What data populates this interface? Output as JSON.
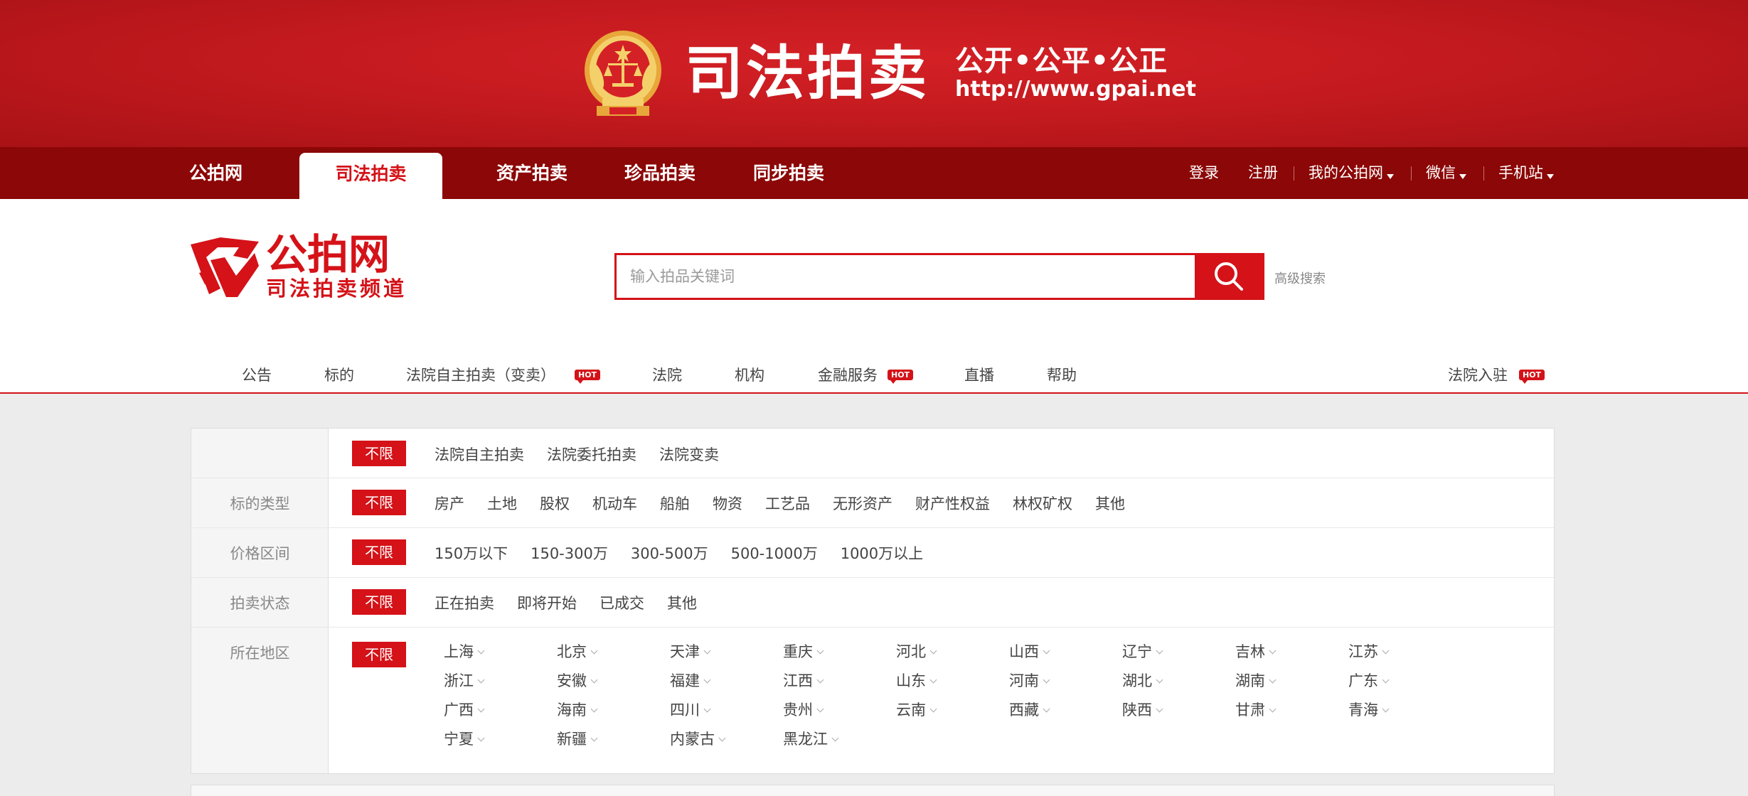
{
  "banner": {
    "title": "司法拍卖",
    "motto": "公开•公平•公正",
    "url": "http://www.gpai.net"
  },
  "topnav": {
    "brand": "公拍网",
    "active_tab": "司法拍卖",
    "tabs": [
      "资产拍卖",
      "珍品拍卖",
      "同步拍卖"
    ],
    "login": "登录",
    "register": "注册",
    "my_account": "我的公拍网",
    "wechat": "微信",
    "mobile": "手机站"
  },
  "logo": {
    "main": "公拍网",
    "sub": "司法拍卖频道"
  },
  "search": {
    "placeholder": "输入拍品关键词",
    "value": "",
    "advanced": "高级搜索"
  },
  "mainnav": {
    "items": [
      "公告",
      "标的",
      "法院自主拍卖（变卖）",
      "法院",
      "机构",
      "金融服务",
      "直播",
      "帮助"
    ],
    "right": "法院入驻",
    "hot_label": "HOT"
  },
  "filters": {
    "unlimited": "不限",
    "rows": [
      {
        "label": "",
        "options": [
          "法院自主拍卖",
          "法院委托拍卖",
          "法院变卖"
        ]
      },
      {
        "label": "标的类型",
        "options": [
          "房产",
          "土地",
          "股权",
          "机动车",
          "船舶",
          "物资",
          "工艺品",
          "无形资产",
          "财产性权益",
          "林权矿权",
          "其他"
        ]
      },
      {
        "label": "价格区间",
        "options": [
          "150万以下",
          "150-300万",
          "300-500万",
          "500-1000万",
          "1000万以上"
        ]
      },
      {
        "label": "拍卖状态",
        "options": [
          "正在拍卖",
          "即将开始",
          "已成交",
          "其他"
        ]
      }
    ],
    "region_label": "所在地区",
    "regions": [
      "上海",
      "北京",
      "天津",
      "重庆",
      "河北",
      "山西",
      "辽宁",
      "吉林",
      "江苏",
      "浙江",
      "安徽",
      "福建",
      "江西",
      "山东",
      "河南",
      "湖北",
      "湖南",
      "广东",
      "广西",
      "海南",
      "四川",
      "贵州",
      "云南",
      "西藏",
      "陕西",
      "甘肃",
      "青海",
      "宁夏",
      "新疆",
      "内蒙古",
      "黑龙江"
    ]
  },
  "colors": {
    "brand_red": "#d41218",
    "dark_red_bar": "#8c0707",
    "banner_red": "#c41a1f",
    "gold": "#f2c341"
  }
}
